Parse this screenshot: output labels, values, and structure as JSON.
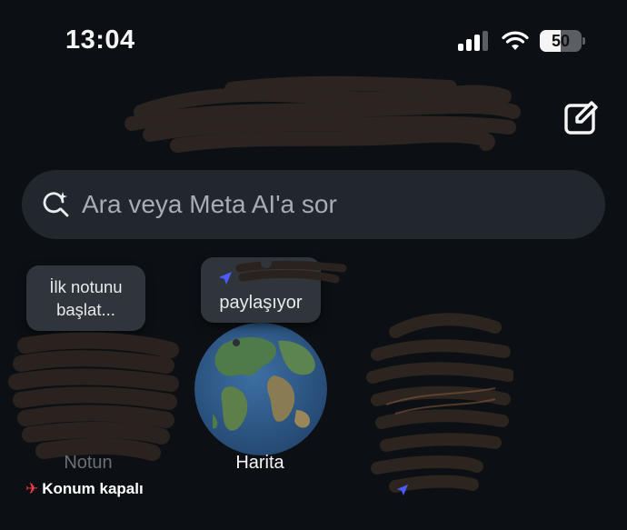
{
  "status_bar": {
    "time": "13:04",
    "battery_level": "50"
  },
  "header": {
    "compose_icon": "compose-icon"
  },
  "search": {
    "placeholder": "Ara veya Meta AI'a sor",
    "icon": "meta-ai-search-icon"
  },
  "stories": [
    {
      "note": "İlk notunu\nbaşlat...",
      "label": "Notun",
      "status": "Konum kapalı"
    },
    {
      "note": "paylaşıyor",
      "label": "Harita"
    },
    {
      "label": ""
    }
  ],
  "colors": {
    "background": "#0c1014",
    "search_bg": "#22272d",
    "bubble_bg": "#30353b",
    "location_off": "#f03c48",
    "arrow": "#4a5cff"
  }
}
